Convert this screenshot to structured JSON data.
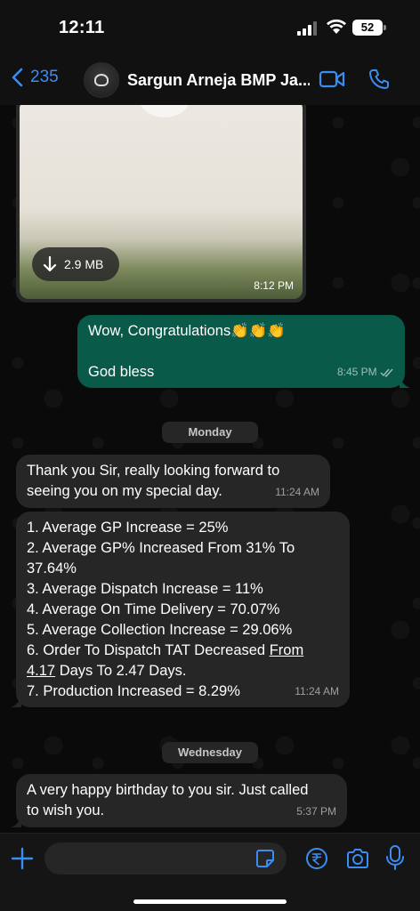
{
  "status": {
    "time": "12:11",
    "battery": "52"
  },
  "header": {
    "back_count": "235",
    "chat_name": "Sargun Arneja BMP Ja..."
  },
  "media": {
    "size": "2.9 MB",
    "time": "8:12 PM"
  },
  "messages": [
    {
      "line1": "Wow, Congratulations👏👏👏",
      "line2": "God bless",
      "time": "8:45 PM"
    },
    {
      "line1": "Thank you Sir, really looking forward to",
      "line2": "seeing you on my special day.",
      "time": "11:24 AM"
    },
    {
      "lines": [
        "1. Average GP Increase = 25%",
        "2. Average GP% Increased From 31% To",
        "37.64%",
        "3. Average Dispatch Increase = 11%",
        "4. Average On Time Delivery = 70.07%",
        "5. Average Collection Increase = 29.06%",
        "6. Order To Dispatch TAT Decreased ",
        "From",
        "4.17",
        " Days To 2.47 Days.",
        "7. Production Increased = 8.29%"
      ],
      "time": "11:24 AM"
    },
    {
      "line1": "A very happy birthday to you sir. Just called",
      "line2": "to wish you.",
      "time": "5:37 PM"
    }
  ],
  "dates": {
    "first": "Monday",
    "second": "Wednesday"
  },
  "composer": {
    "placeholder": ""
  },
  "colors": {
    "accent": "#3a8df5",
    "outgoing_bubble": "#0a5a4a",
    "incoming_bubble": "#262626"
  }
}
